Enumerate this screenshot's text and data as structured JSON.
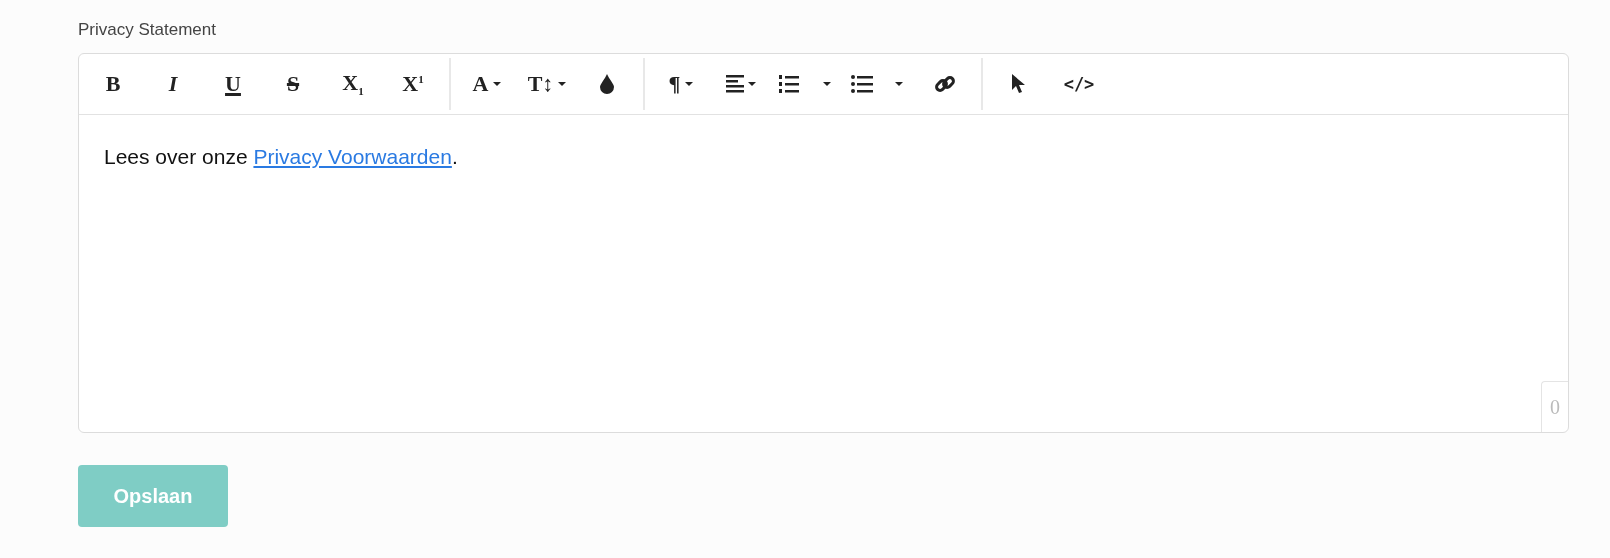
{
  "field_label": "Privacy Statement",
  "toolbar": [
    [
      {
        "kind": "bold",
        "glyph": "B"
      },
      {
        "kind": "italic",
        "glyph": "I"
      },
      {
        "kind": "underline",
        "glyph": "U"
      },
      {
        "kind": "strike",
        "glyph": "S"
      },
      {
        "kind": "script",
        "glyph": "X$_{1}$"
      },
      {
        "kind": "script",
        "glyph": "X$^{1}$"
      }
    ],
    [
      {
        "kind": "text-dropdown",
        "glyph": "A"
      },
      {
        "kind": "text-dropdown",
        "glyph": "T↕"
      },
      {
        "kind": "color"
      }
    ],
    [
      {
        "kind": "text-dropdown",
        "glyph": "¶"
      },
      {
        "kind": "align"
      },
      {
        "kind": "ordered-list"
      },
      {
        "kind": "bullet-list"
      },
      {
        "kind": "link"
      }
    ],
    [
      {
        "kind": "pointer"
      },
      {
        "kind": "code",
        "glyph": "</>"
      }
    ]
  ],
  "content": {
    "before": "Lees over onze ",
    "link": "Privacy Voorwaarden",
    "after": "."
  },
  "counter": "0",
  "save_button": "Opslaan"
}
